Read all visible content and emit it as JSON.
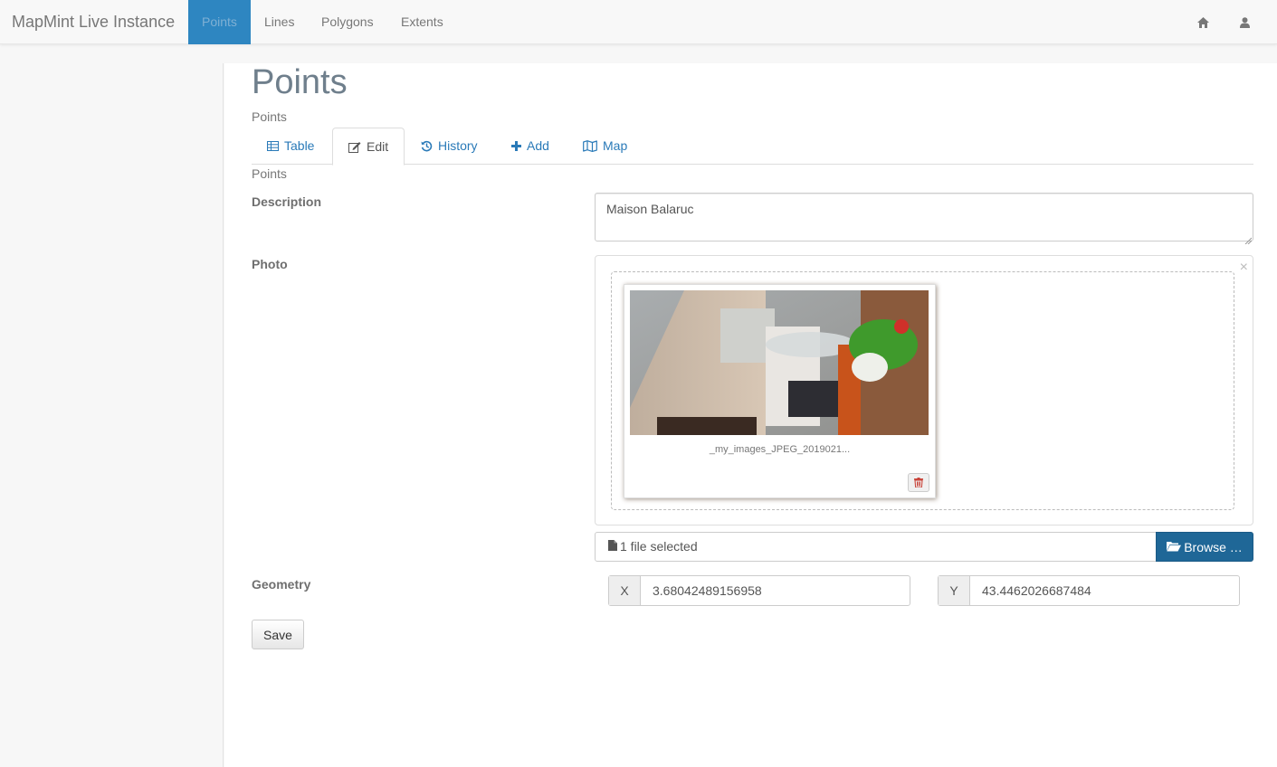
{
  "navbar": {
    "brand": "MapMint Live Instance",
    "items": [
      {
        "label": "Points",
        "active": true
      },
      {
        "label": "Lines",
        "active": false
      },
      {
        "label": "Polygons",
        "active": false
      },
      {
        "label": "Extents",
        "active": false
      }
    ],
    "right_icons": [
      "home-icon",
      "user-icon"
    ]
  },
  "page": {
    "title": "Points",
    "subtitle": "Points",
    "tabs": [
      {
        "label": "Table",
        "icon": "table-icon",
        "active": false
      },
      {
        "label": "Edit",
        "icon": "edit-icon",
        "active": true
      },
      {
        "label": "History",
        "icon": "history-icon",
        "active": false
      },
      {
        "label": "Add",
        "icon": "plus-icon",
        "active": false
      },
      {
        "label": "Map",
        "icon": "map-icon",
        "active": false
      }
    ],
    "section_label": "Points"
  },
  "form": {
    "description_label": "Description",
    "description_value": "Maison Balaruc",
    "photo_label": "Photo",
    "photo_caption": "_my_images_JPEG_2019021...",
    "file_status": "1 file selected",
    "browse_label": "Browse …",
    "geometry_label": "Geometry",
    "x_addon": "X",
    "x_value": "3.68042489156958",
    "y_addon": "Y",
    "y_value": "43.4462026687484",
    "save_label": "Save"
  },
  "colors": {
    "accent": "#2e86c1",
    "browse": "#1f6797",
    "link": "#2a7ab8"
  }
}
